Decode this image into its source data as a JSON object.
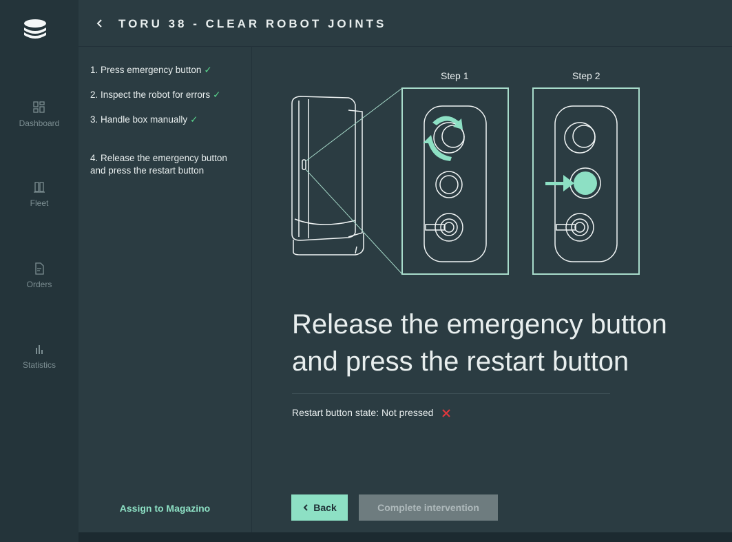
{
  "sidebar": {
    "items": [
      {
        "label": "Dashboard",
        "icon": "dashboard-icon"
      },
      {
        "label": "Fleet",
        "icon": "fleet-icon"
      },
      {
        "label": "Orders",
        "icon": "orders-icon"
      },
      {
        "label": "Statistics",
        "icon": "statistics-icon"
      }
    ]
  },
  "header": {
    "title": "TORU 38 - CLEAR ROBOT JOINTS"
  },
  "steps": [
    {
      "text": "1. Press emergency button",
      "done": true
    },
    {
      "text": "2. Inspect the robot for errors",
      "done": true
    },
    {
      "text": "3. Handle box manually",
      "done": true
    },
    {
      "text": "4. Release the emergency button\nand press the restart button",
      "done": false
    }
  ],
  "assign_label": "Assign to Magazino",
  "illustration": {
    "step1_label": "Step 1",
    "step2_label": "Step 2"
  },
  "instruction": "Release the emergency button\nand press the restart button",
  "restart_state": {
    "label": "Restart button state:",
    "value": "Not pressed",
    "status_icon": "cross-icon"
  },
  "buttons": {
    "back": "Back",
    "complete": "Complete intervention"
  },
  "colors": {
    "accent": "#8de0c4",
    "check": "#5ad88e",
    "error": "#e0383e"
  }
}
